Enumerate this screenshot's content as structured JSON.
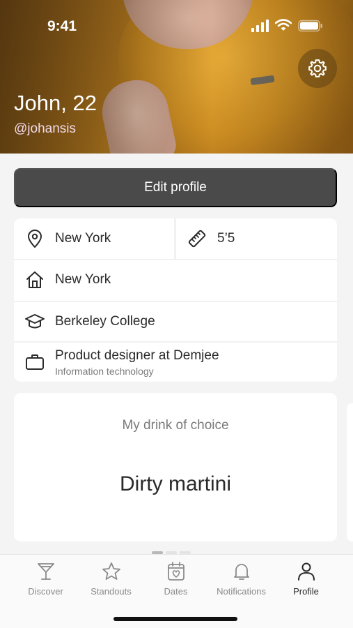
{
  "status_bar": {
    "time": "9:41"
  },
  "header": {
    "name": "John, 22",
    "handle": "@johansis",
    "settings_icon": "gear-icon"
  },
  "actions": {
    "edit_profile_label": "Edit profile"
  },
  "info": {
    "location": {
      "icon": "location-pin-icon",
      "text": "New York"
    },
    "height": {
      "icon": "ruler-icon",
      "text": "5’5"
    },
    "hometown": {
      "icon": "home-icon",
      "text": "New York"
    },
    "education": {
      "icon": "graduation-cap-icon",
      "text": "Berkeley College"
    },
    "work": {
      "icon": "briefcase-icon",
      "title": "Product designer at Demjee",
      "industry": "Information technology"
    }
  },
  "prompt_card": {
    "prompt": "My drink of choice",
    "answer": "Dirty martini"
  },
  "carousel": {
    "pages": 3,
    "active_index": 0
  },
  "tabs": [
    {
      "label": "Discover",
      "icon": "cocktail-glass-icon",
      "active": false
    },
    {
      "label": "Standouts",
      "icon": "star-icon",
      "active": false
    },
    {
      "label": "Dates",
      "icon": "calendar-heart-icon",
      "active": false
    },
    {
      "label": "Notifications",
      "icon": "bell-icon",
      "active": false
    },
    {
      "label": "Profile",
      "icon": "person-icon",
      "active": true
    }
  ],
  "colors": {
    "edit_button": "#4a4a4a",
    "handle": "#f2d9e7",
    "background": "#f4f4f4",
    "tab_active": "#2a2a2a",
    "tab_inactive": "#8a8a8a"
  }
}
